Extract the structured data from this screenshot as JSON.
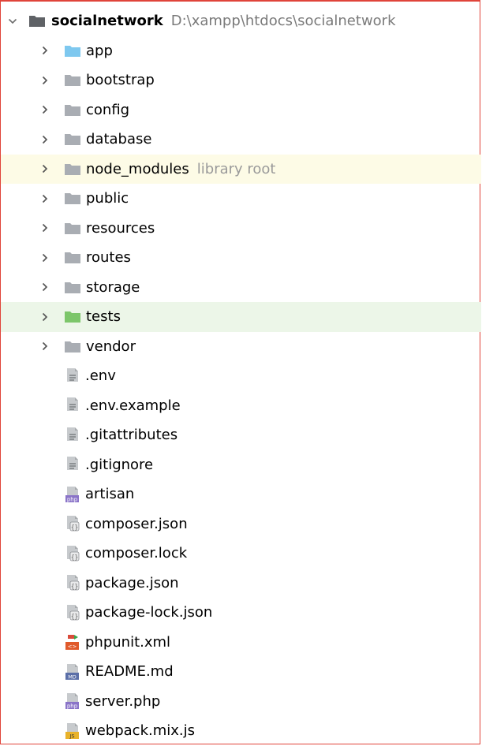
{
  "root": {
    "name": "socialnetwork",
    "path": "D:\\xampp\\htdocs\\socialnetwork",
    "expanded": true,
    "icon": "folder-icon",
    "icon_color": "#5f6266"
  },
  "folders": [
    {
      "name": "app",
      "color": "#7ec8ef",
      "note": "",
      "highlight": ""
    },
    {
      "name": "bootstrap",
      "color": "#a9adb3",
      "note": "",
      "highlight": ""
    },
    {
      "name": "config",
      "color": "#a9adb3",
      "note": "",
      "highlight": ""
    },
    {
      "name": "database",
      "color": "#a9adb3",
      "note": "",
      "highlight": ""
    },
    {
      "name": "node_modules",
      "color": "#a9adb3",
      "note": "library root",
      "highlight": "yellow"
    },
    {
      "name": "public",
      "color": "#a9adb3",
      "note": "",
      "highlight": ""
    },
    {
      "name": "resources",
      "color": "#a9adb3",
      "note": "",
      "highlight": ""
    },
    {
      "name": "routes",
      "color": "#a9adb3",
      "note": "",
      "highlight": ""
    },
    {
      "name": "storage",
      "color": "#a9adb3",
      "note": "",
      "highlight": ""
    },
    {
      "name": "tests",
      "color": "#7cc66a",
      "note": "",
      "highlight": "green"
    },
    {
      "name": "vendor",
      "color": "#a9adb3",
      "note": "",
      "highlight": ""
    }
  ],
  "files": [
    {
      "name": ".env",
      "icon": "text-file-icon"
    },
    {
      "name": ".env.example",
      "icon": "text-file-icon"
    },
    {
      "name": ".gitattributes",
      "icon": "text-file-icon"
    },
    {
      "name": ".gitignore",
      "icon": "text-file-icon"
    },
    {
      "name": "artisan",
      "icon": "php-file-icon"
    },
    {
      "name": "composer.json",
      "icon": "json-file-icon"
    },
    {
      "name": "composer.lock",
      "icon": "json-file-icon"
    },
    {
      "name": "package.json",
      "icon": "json-file-icon"
    },
    {
      "name": "package-lock.json",
      "icon": "json-file-icon"
    },
    {
      "name": "phpunit.xml",
      "icon": "xml-file-icon"
    },
    {
      "name": "README.md",
      "icon": "markdown-file-icon"
    },
    {
      "name": "server.php",
      "icon": "php-file-icon"
    },
    {
      "name": "webpack.mix.js",
      "icon": "js-file-icon"
    }
  ],
  "badges": {
    "php": "php",
    "md": "MD",
    "js": "JS",
    "xml": "<>",
    "json": "{}"
  },
  "colors": {
    "frame_border": "#e0443a",
    "highlight_yellow": "#fdfbe6",
    "highlight_green": "#ecf6e8",
    "php_badge": "#8a74c8",
    "md_badge": "#5b6fa8",
    "js_badge": "#e8b22a",
    "xml_badge": "#e05a2b"
  }
}
